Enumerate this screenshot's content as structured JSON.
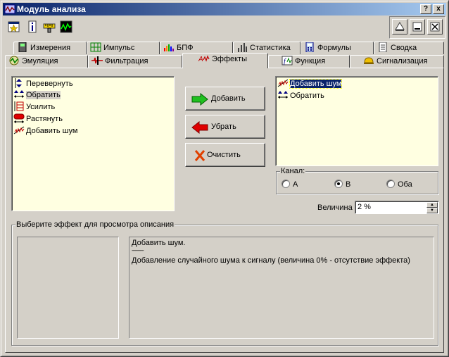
{
  "window": {
    "title": "Модуль анализа"
  },
  "titlebar_buttons": [
    "?",
    "x"
  ],
  "toolbar": {
    "icons": [
      "star-icon",
      "info-icon",
      "ruler-icon",
      "oscilloscope-icon"
    ]
  },
  "right_toolbar": {
    "icons": [
      "save-icon",
      "minimize-panel-icon",
      "close-panel-icon"
    ]
  },
  "tabs": {
    "row1": [
      "Измерения",
      "Импульс",
      "БПФ",
      "Статистика",
      "Формулы",
      "Сводка"
    ],
    "row2": [
      "Эмуляция",
      "Фильтрация",
      "Эффекты",
      "Функция",
      "Сигнализация"
    ],
    "active": "Эффекты"
  },
  "effects_list": {
    "items": [
      "Перевернуть",
      "Обратить",
      "Усилить",
      "Растянуть",
      "Добавить шум"
    ],
    "selected": "Обратить"
  },
  "buttons": {
    "add": "Добавить",
    "remove": "Убрать",
    "clear": "Очистить"
  },
  "applied_list": {
    "items": [
      "Добавить шум",
      "Обратить"
    ],
    "selected": "Добавить шум"
  },
  "channel": {
    "label": "Канал:",
    "options": [
      "A",
      "B",
      "Оба"
    ],
    "selected": "B"
  },
  "magnitude": {
    "label": "Величина",
    "value": "2 %"
  },
  "description": {
    "label": "Выберите эффект для просмотра описания",
    "title": "Добавить шум.",
    "separator": "----------",
    "text": "Добавление случайного шума к сигналу (величина 0% - отсутствие эффекта)"
  },
  "colors": {
    "title_start": "#0a246a",
    "title_end": "#a6caf0",
    "list_bg": "#ffffe1"
  }
}
